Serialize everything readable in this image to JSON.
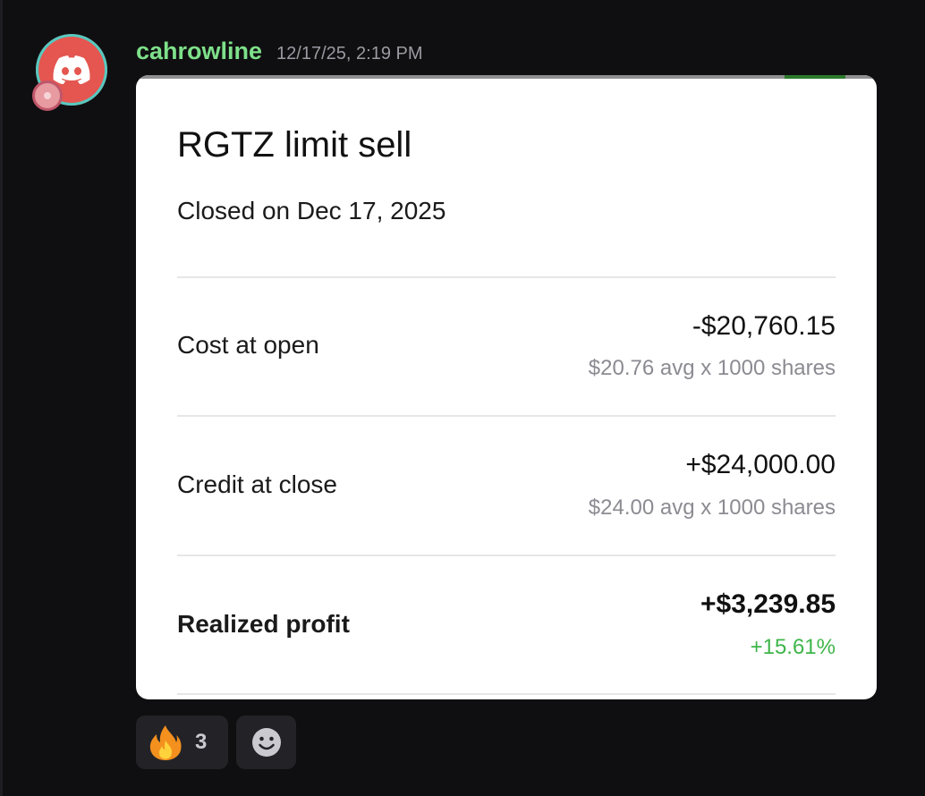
{
  "message": {
    "username": "cahrowline",
    "timestamp": "12/17/25, 2:19 PM"
  },
  "card": {
    "title": "RGTZ limit sell",
    "subtitle": "Closed on Dec 17, 2025",
    "rows": [
      {
        "label": "Cost at open",
        "value": "-$20,760.15",
        "sub": "$20.76 avg x 1000 shares"
      },
      {
        "label": "Credit at close",
        "value": "+$24,000.00",
        "sub": "$24.00 avg x 1000 shares"
      },
      {
        "label": "Realized profit",
        "value": "+$3,239.85",
        "sub": "+15.61%"
      }
    ]
  },
  "reactions": [
    {
      "emoji": "fire-icon",
      "count": "3"
    },
    {
      "emoji": "add-reaction-icon"
    }
  ],
  "colors": {
    "username": "#7ee08a",
    "profit_green": "#3fb54a",
    "background": "#0f0f11",
    "avatar": "#e4564f"
  }
}
